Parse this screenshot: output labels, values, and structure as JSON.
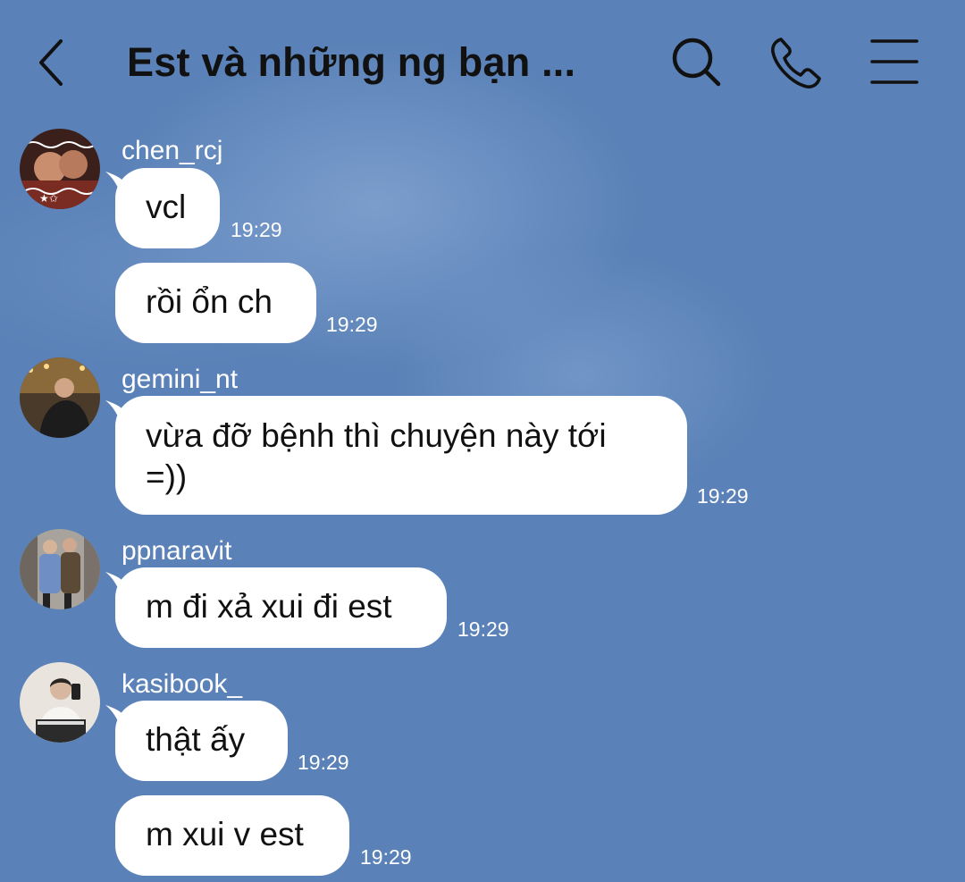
{
  "header": {
    "title": "Est và những ng bạn ...",
    "back_icon": "chevron-left-icon",
    "search_icon": "search-icon",
    "call_icon": "phone-icon",
    "menu_icon": "menu-icon"
  },
  "colors": {
    "background": "#5b82b8",
    "bubble": "#ffffff",
    "text": "#111111"
  },
  "messages": [
    {
      "sender": "chen_rcj",
      "text": "vcl",
      "time": "19:29"
    },
    {
      "sender": "",
      "text": "rồi ổn ch",
      "time": "19:29"
    },
    {
      "sender": "gemini_nt",
      "text": "vừa đỡ bệnh thì chuyện này tới =))",
      "time": "19:29"
    },
    {
      "sender": "ppnaravit",
      "text": "m đi xả xui đi est",
      "time": "19:29"
    },
    {
      "sender": "kasibook_",
      "text": "thật ấy",
      "time": "19:29"
    },
    {
      "sender": "",
      "text": "m xui v est",
      "time": "19:29"
    }
  ]
}
